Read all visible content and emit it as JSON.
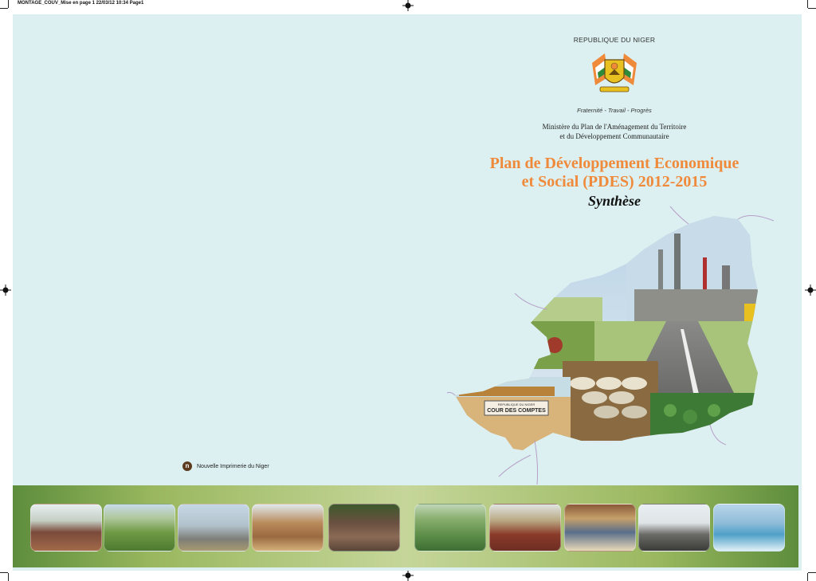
{
  "slug_line": "MONTAGE_COUV_Mise en page 1 22/03/12 10:34 Page1",
  "header": {
    "country": "REPUBLIQUE DU NIGER",
    "motto": "Fraternité - Travail - Progrès",
    "ministry_line1": "Ministère du Plan de l'Aménagement du Territoire",
    "ministry_line2": "et du Développement Communautaire"
  },
  "title": {
    "line1": "Plan de Développement Economique",
    "line2": "et Social (PDES) 2012-2015",
    "subtitle": "Synthèse"
  },
  "map_photos": {
    "sign_text_small": "REPUBLIQUE DU NIGER",
    "sign_text": "COUR DES COMPTES"
  },
  "publisher": {
    "logo_letter": "n",
    "name": "Nouvelle Imprimerie du Niger"
  },
  "colors": {
    "background": "#dcf0f1",
    "title_orange": "#f08a3b",
    "strip_green": "#7ea64a"
  },
  "thumbnails": [
    {
      "icon": "livestock-market-photo"
    },
    {
      "icon": "millet-field-photo"
    },
    {
      "icon": "refinery-photo"
    },
    {
      "icon": "school-building-photo"
    },
    {
      "icon": "railway-photo"
    },
    {
      "icon": "farm-workers-photo"
    },
    {
      "icon": "cattle-herd-photo"
    },
    {
      "icon": "classroom-photo"
    },
    {
      "icon": "mining-photo"
    },
    {
      "icon": "dam-photo"
    }
  ]
}
